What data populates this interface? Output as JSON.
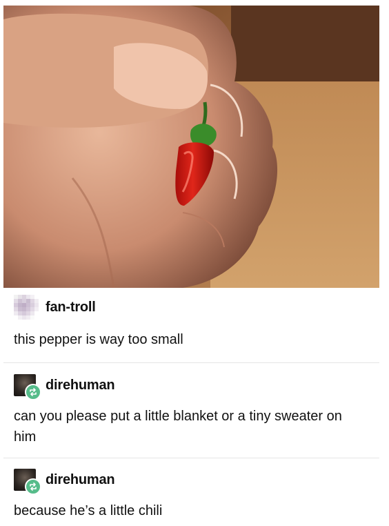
{
  "image": {
    "description_icon": "photo-of-tiny-chili-pepper-held-between-fingers"
  },
  "posts": [
    {
      "username": "fan-troll",
      "text": "this pepper is way too small",
      "avatar_icon": "pixelated-avatar-icon",
      "reblogged": false
    },
    {
      "username": "direhuman",
      "text": "can you please put a little blanket or a tiny sweater on him",
      "avatar_icon": "dark-avatar-icon",
      "reblogged": true
    },
    {
      "username": "direhuman",
      "text": "because he’s a little chili",
      "avatar_icon": "dark-avatar-icon",
      "reblogged": true
    }
  ],
  "colors": {
    "reblog_badge": "#56bc8a",
    "divider": "#e5e5e5"
  }
}
